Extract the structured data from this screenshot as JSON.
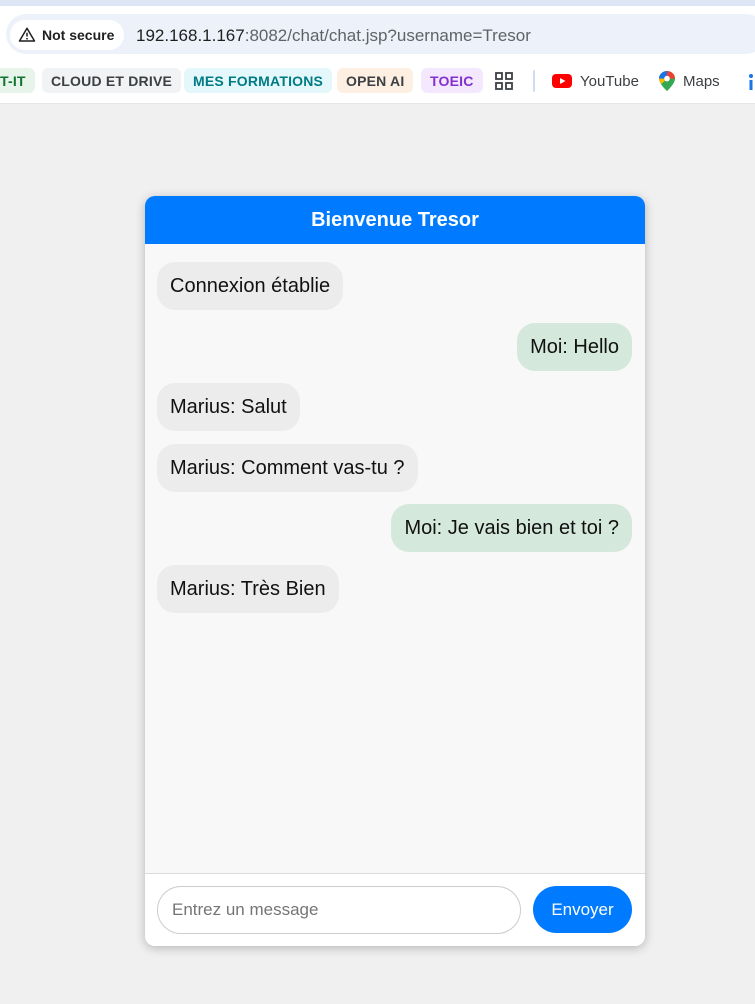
{
  "browser": {
    "security_label": "Not secure",
    "url_host": "192.168.1.167",
    "url_path": ":8082/chat/chat.jsp?username=Tresor",
    "bookmarks": [
      {
        "label": "T-IT",
        "bg": "#e6f4ea",
        "color": "#137333"
      },
      {
        "label": "CLOUD ET DRIVE",
        "bg": "#f1f3f4",
        "color": "#3c4043"
      },
      {
        "label": "MES FORMATIONS",
        "bg": "#e4f7fb",
        "color": "#007b83"
      },
      {
        "label": "OPEN AI",
        "bg": "#feefe3",
        "color": "#3c4043"
      },
      {
        "label": "TOEIC",
        "bg": "#f3e8fd",
        "color": "#8430ce"
      }
    ],
    "links": [
      {
        "label": "YouTube",
        "icon": "youtube-icon"
      },
      {
        "label": "Maps",
        "icon": "maps-icon"
      }
    ]
  },
  "chat": {
    "header_title": "Bienvenue Tresor",
    "messages": [
      {
        "text": "Connexion établie",
        "from": "other"
      },
      {
        "text": "Moi: Hello",
        "from": "me"
      },
      {
        "text": "Marius: Salut",
        "from": "other"
      },
      {
        "text": "Marius: Comment vas-tu ?",
        "from": "other"
      },
      {
        "text": "Moi: Je vais bien et toi ?",
        "from": "me"
      },
      {
        "text": "Marius: Très Bien",
        "from": "other"
      }
    ],
    "input_placeholder": "Entrez un message",
    "input_value": "",
    "send_label": "Envoyer"
  },
  "colors": {
    "accent": "#007bff",
    "other_bubble": "#ececec",
    "my_bubble": "#d4e8dc"
  }
}
